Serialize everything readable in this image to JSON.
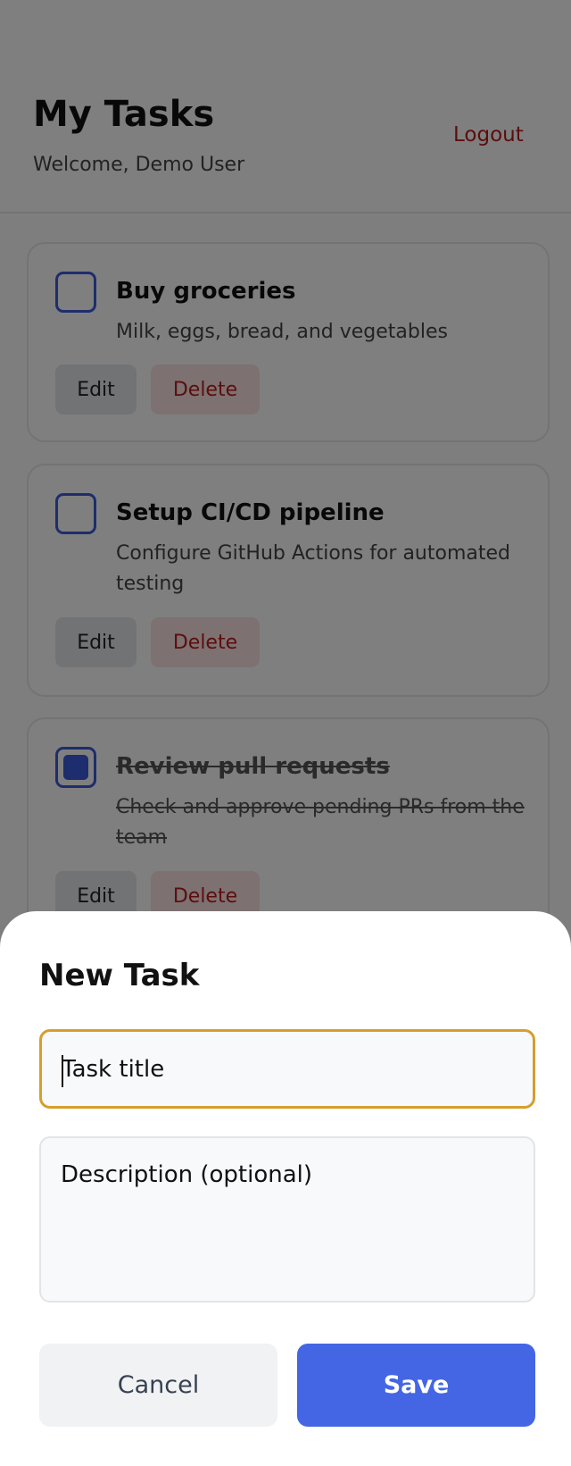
{
  "header": {
    "title": "My Tasks",
    "welcome": "Welcome, Demo User",
    "logout": "Logout"
  },
  "tasks": [
    {
      "title": "Buy groceries",
      "description": "Milk, eggs, bread, and vegetables",
      "completed": false,
      "edit": "Edit",
      "delete": "Delete"
    },
    {
      "title": "Setup CI/CD pipeline",
      "description": "Configure GitHub Actions for automated testing",
      "completed": false,
      "edit": "Edit",
      "delete": "Delete"
    },
    {
      "title": "Review pull requests",
      "description": "Check and approve pending PRs from the team",
      "completed": true,
      "edit": "Edit",
      "delete": "Delete"
    }
  ],
  "modal": {
    "title": "New Task",
    "title_placeholder": "Task title",
    "title_value": "",
    "description_placeholder": "Description (optional)",
    "description_value": "",
    "cancel": "Cancel",
    "save": "Save"
  },
  "colors": {
    "accent": "#4466e4",
    "danger": "#b91c1c",
    "focus": "#d69e2e"
  }
}
